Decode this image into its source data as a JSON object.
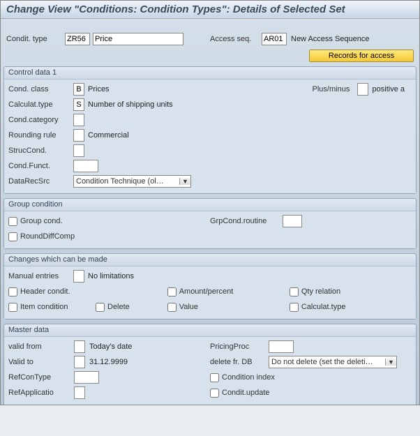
{
  "title": "Change View \"Conditions: Condition Types\": Details of Selected Set",
  "top": {
    "condit_type_label": "Condit. type",
    "condit_type_code": "ZR56",
    "condit_type_desc": "Price",
    "access_seq_label": "Access seq.",
    "access_seq_code": "AR01",
    "access_seq_desc": "New Access Sequence",
    "records_btn": "Records for access"
  },
  "control1": {
    "title": "Control data 1",
    "cond_class_label": "Cond. class",
    "cond_class_code": "B",
    "cond_class_text": "Prices",
    "plus_minus_label": "Plus/minus",
    "plus_minus_text": "positive a",
    "calc_type_label": "Calculat.type",
    "calc_type_code": "S",
    "calc_type_text": "Number of shipping units",
    "cond_category_label": "Cond.category",
    "rounding_label": "Rounding rule",
    "rounding_text": "Commercial",
    "struc_label": "StrucCond.",
    "cond_funct_label": "Cond.Funct.",
    "datarec_label": "DataRecSrc",
    "datarec_value": "Condition Technique (ol…"
  },
  "group_cond": {
    "title": "Group condition",
    "group_cond_label": "Group cond.",
    "round_diff_label": "RoundDiffComp",
    "grp_routine_label": "GrpCond.routine"
  },
  "changes": {
    "title": "Changes which can be made",
    "manual_label": "Manual entries",
    "manual_text": "No limitations",
    "header_label": "Header condit.",
    "amount_label": "Amount/percent",
    "qty_label": "Qty relation",
    "item_label": "Item condition",
    "delete_label": "Delete",
    "value_label": "Value",
    "calc_label": "Calculat.type"
  },
  "master": {
    "title": "Master data",
    "valid_from_label": "valid from",
    "valid_from_text": "Today's date",
    "pricing_proc_label": "PricingProc",
    "valid_to_label": "Valid to",
    "valid_to_text": "31.12.9999",
    "delete_db_label": "delete fr. DB",
    "delete_db_value": "Do not delete (set the deleti…",
    "refcon_label": "RefConType",
    "cond_index_label": "Condition index",
    "refapp_label": "RefApplicatio",
    "cond_update_label": "Condit.update"
  }
}
